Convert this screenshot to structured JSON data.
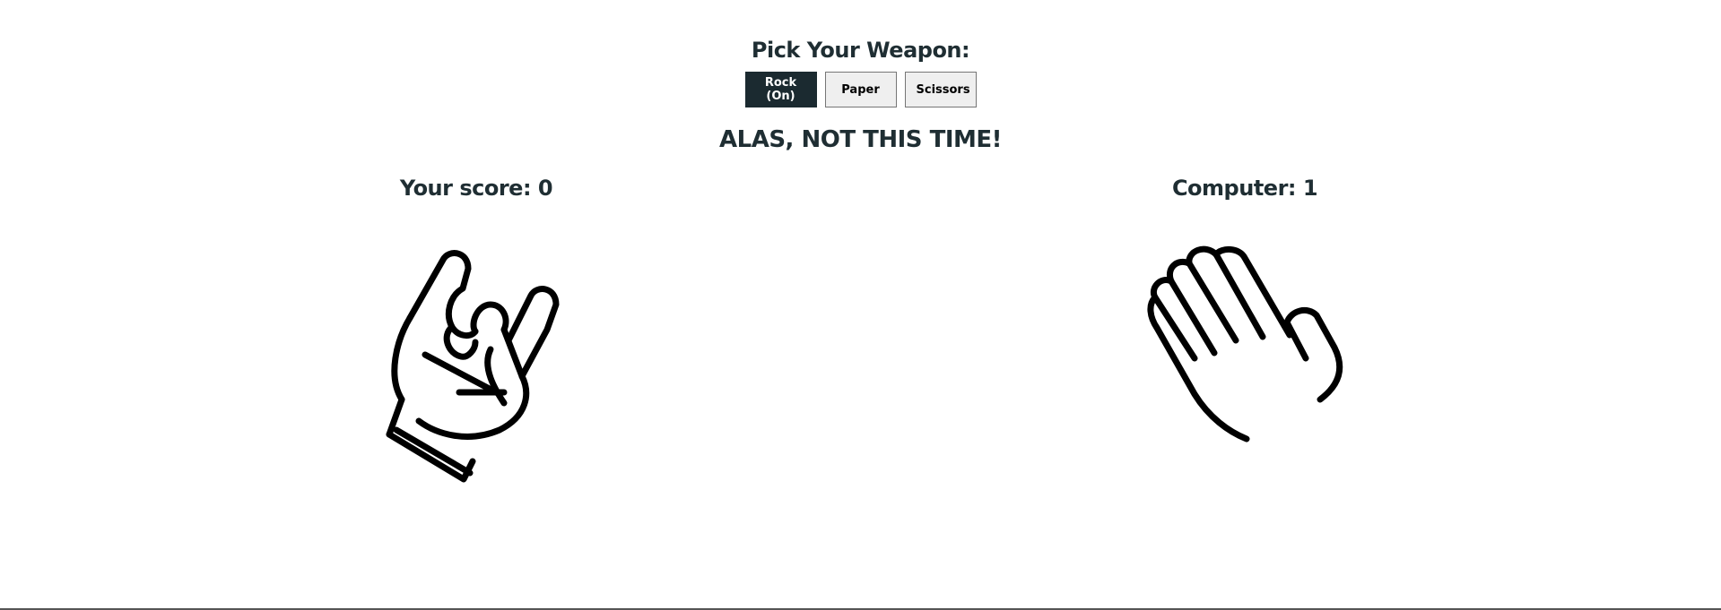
{
  "heading": "Pick Your Weapon:",
  "weapons": {
    "rock": "Rock (On)",
    "paper": "Paper",
    "scissors": "Scissors",
    "selected": "rock"
  },
  "result": "ALAS, NOT THIS TIME!",
  "scores": {
    "player_label": "Your score: 0",
    "computer_label": "Computer: 1",
    "player": 0,
    "computer": 1
  },
  "hands": {
    "player": "rock-on-hand-icon",
    "computer": "paper-hand-icon"
  },
  "colors": {
    "text": "#1f2e33",
    "active_button": "#1b2a30",
    "button": "#efefef"
  }
}
